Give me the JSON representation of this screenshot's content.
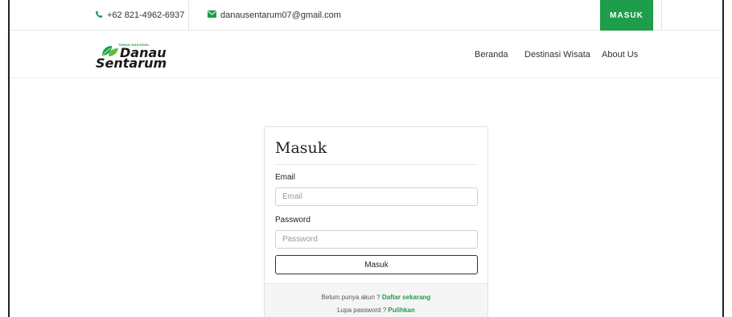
{
  "topbar": {
    "phone": "+62 821-4962-6937",
    "email": "danausentarum07@gmail.com",
    "login_button": "MASUK",
    "accent_color": "#1e9e4a"
  },
  "logo": {
    "tagline": "TAMAN NASIONAL",
    "line1": "Danau",
    "line2": "Sentarum"
  },
  "nav": {
    "items": [
      {
        "label": "Beranda"
      },
      {
        "label": "Destinasi Wisata"
      },
      {
        "label": "About Us"
      }
    ]
  },
  "login_form": {
    "title": "Masuk",
    "email_label": "Email",
    "email_placeholder": "Email",
    "password_label": "Password",
    "password_placeholder": "Password",
    "submit_label": "Masuk",
    "register_prompt": "Belum punya akun ?",
    "register_link": "Daftar sekarang",
    "forgot_prompt": "Lupa password ?",
    "forgot_link": "Pulihkan"
  },
  "icons": {
    "phone": "phone-icon",
    "email": "envelope-icon"
  }
}
